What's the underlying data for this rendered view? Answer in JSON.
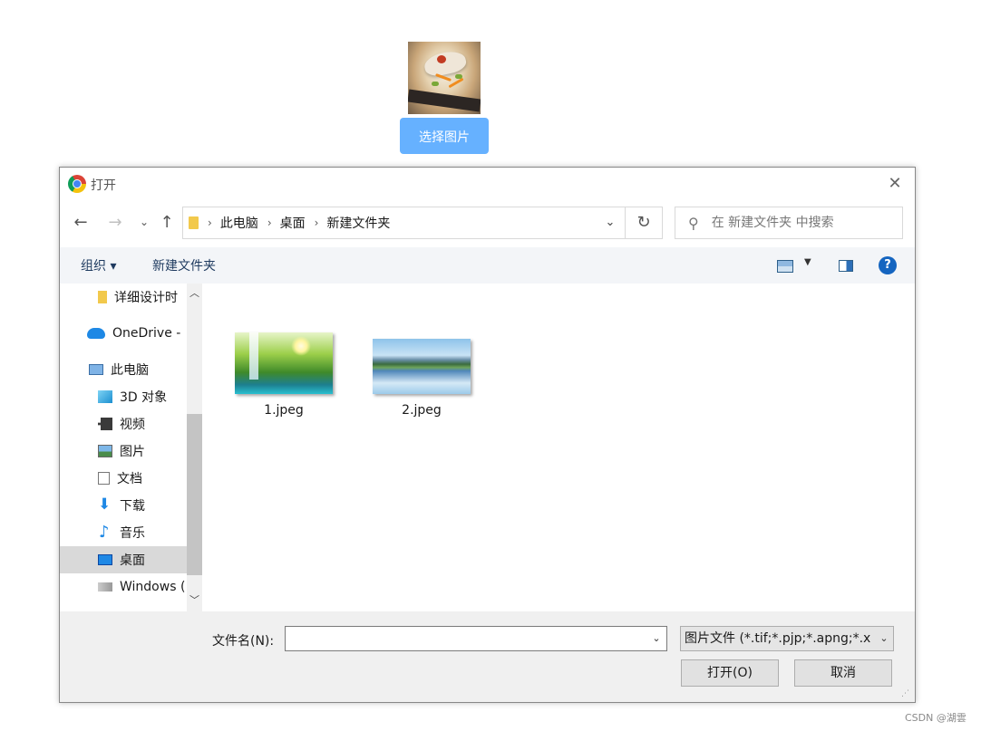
{
  "page": {
    "choose_button": "选择图片",
    "watermark": "CSDN @湖雲"
  },
  "dialog": {
    "title": "打开",
    "close_glyph": "✕",
    "nav": {
      "back": "←",
      "forward": "→",
      "recent": "⌄",
      "up": "↑",
      "refresh": "↻"
    },
    "breadcrumb": [
      "此电脑",
      "桌面",
      "新建文件夹"
    ],
    "breadcrumb_sep": "›",
    "search_placeholder": "在 新建文件夹 中搜索",
    "toolbar": {
      "organize": "组织 ▾",
      "new_folder": "新建文件夹",
      "help": "?"
    },
    "sidebar": [
      {
        "label": "详细设计时",
        "icon": "folder-icon"
      },
      {
        "label": "OneDrive -",
        "icon": "onedrive-icon"
      },
      {
        "label": "此电脑",
        "icon": "computer-icon"
      },
      {
        "label": "3D 对象",
        "icon": "3d-objects-icon"
      },
      {
        "label": "视频",
        "icon": "video-icon"
      },
      {
        "label": "图片",
        "icon": "pictures-icon"
      },
      {
        "label": "文档",
        "icon": "documents-icon"
      },
      {
        "label": "下载",
        "icon": "download-icon"
      },
      {
        "label": "音乐",
        "icon": "music-icon"
      },
      {
        "label": "桌面",
        "icon": "desktop-icon",
        "selected": true
      },
      {
        "label": "Windows (",
        "icon": "drive-icon"
      }
    ],
    "files": [
      {
        "name": "1.jpeg"
      },
      {
        "name": "2.jpeg"
      }
    ],
    "filename_label": "文件名(N):",
    "filename_value": "",
    "file_type": "图片文件 (*.tif;*.pjp;*.apng;*.x",
    "open_button": "打开(O)",
    "cancel_button": "取消"
  }
}
